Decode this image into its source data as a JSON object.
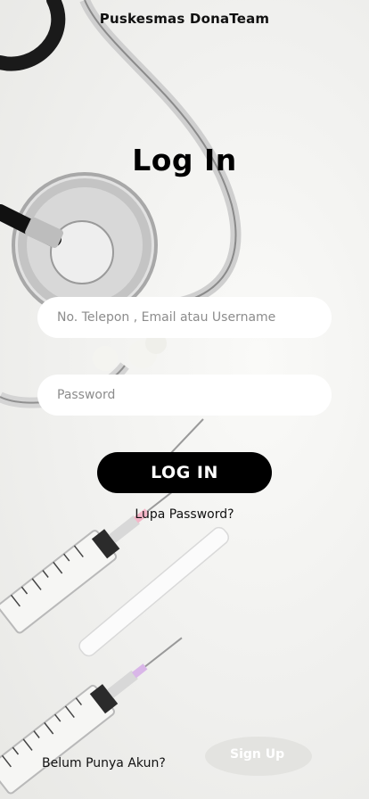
{
  "app": {
    "title": "Puskesmas DonaTeam"
  },
  "login": {
    "heading": "Log In",
    "identifier_placeholder": "No. Telepon , Email atau Username",
    "password_placeholder": "Password",
    "submit_label": "LOG IN",
    "forgot_password": "Lupa Password?"
  },
  "footer": {
    "no_account_text": "Belum Punya Akun?",
    "sign_up_label": "Sign Up"
  },
  "background": {
    "subject": "stethoscope-and-syringes-photo"
  },
  "colors": {
    "button": "#000000",
    "field": "#ffffff",
    "background": "#f1f1ef"
  }
}
